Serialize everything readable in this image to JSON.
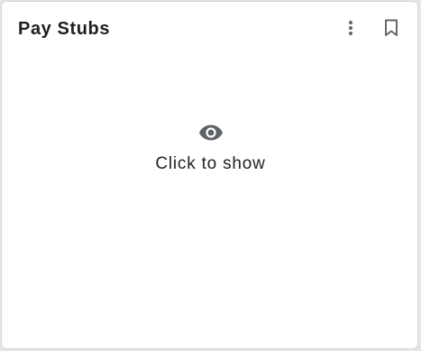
{
  "card": {
    "title": "Pay Stubs",
    "more_icon": "more-vert-icon",
    "bookmark_icon": "bookmark-outline-icon"
  },
  "reveal": {
    "icon": "eye-icon",
    "label": "Click to show"
  },
  "colors": {
    "icon": "#5f6368",
    "title": "#1f1f1f",
    "text": "#222222",
    "card_border": "#d6d6d6"
  }
}
